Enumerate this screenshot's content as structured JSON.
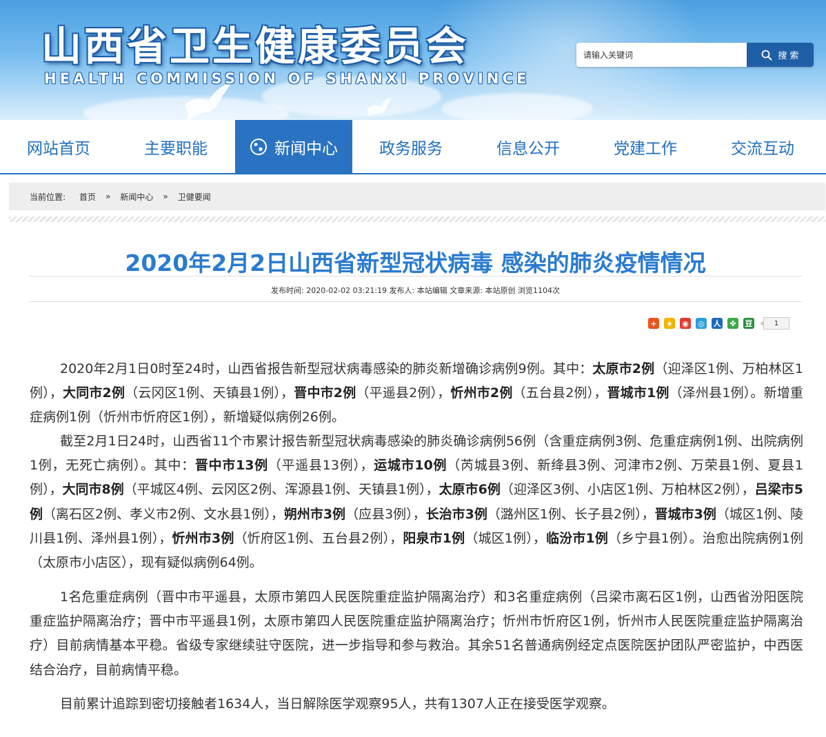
{
  "header": {
    "site_title": "山西省卫生健康委员会",
    "site_subtitle": "HEALTH COMMISSION OF SHANXI PROVINCE",
    "search_placeholder": "请输入关键词",
    "search_button": "搜 索"
  },
  "nav": {
    "items": [
      {
        "label": "网站首页"
      },
      {
        "label": "主要职能"
      },
      {
        "label": "新闻中心",
        "active": true
      },
      {
        "label": "政务服务"
      },
      {
        "label": "信息公开"
      },
      {
        "label": "党建工作"
      },
      {
        "label": "交流互动"
      }
    ]
  },
  "breadcrumb": {
    "lead": "当前位置:",
    "items": [
      "首页",
      "»",
      "新闻中心",
      "»",
      "卫健要闻"
    ]
  },
  "article": {
    "title": "2020年2月2日山西省新型冠状病毒 感染的肺炎疫情情况",
    "meta": "发布时间: 2020-02-02 03:21:19 发布人: 本站编辑 文章来源: 本站原创 浏览1104次",
    "share_count": "1",
    "paragraphs": [
      [
        {
          "t": "2020年2月1日0时至24时，山西省报告新型冠状病毒感染的肺炎新增确诊病例9例。其中："
        },
        {
          "t": "太原市2例",
          "b": true
        },
        {
          "t": "（迎泽区1例、万柏林区1例），"
        },
        {
          "t": "大同市2例",
          "b": true
        },
        {
          "t": "（云冈区1例、天镇县1例），"
        },
        {
          "t": "晋中市2例",
          "b": true
        },
        {
          "t": "（平遥县2例），"
        },
        {
          "t": "忻州市2例",
          "b": true
        },
        {
          "t": "（五台县2例），"
        },
        {
          "t": "晋城市1例",
          "b": true
        },
        {
          "t": "（泽州县1例）。新增重症病例1例（忻州市忻府区1例），新增疑似病例26例。"
        }
      ],
      [
        {
          "t": "截至2月1日24时，山西省11个市累计报告新型冠状病毒感染的肺炎确诊病例56例（含重症病例3例、危重症病例1例、出院病例1例，无死亡病例）。其中："
        },
        {
          "t": "晋中市13例",
          "b": true
        },
        {
          "t": "（平遥县13例），"
        },
        {
          "t": "运城市10例",
          "b": true
        },
        {
          "t": "（芮城县3例、新绛县3例、河津市2例、万荣县1例、夏县1例），"
        },
        {
          "t": "大同市8例",
          "b": true
        },
        {
          "t": "（平城区4例、云冈区2例、浑源县1例、天镇县1例），"
        },
        {
          "t": "太原市6例",
          "b": true
        },
        {
          "t": "（迎泽区3例、小店区1例、万柏林区2例），"
        },
        {
          "t": "吕梁市5例",
          "b": true
        },
        {
          "t": "（离石区2例、孝义市2例、文水县1例），"
        },
        {
          "t": "朔州市3例",
          "b": true
        },
        {
          "t": "（应县3例），"
        },
        {
          "t": "长治市3例",
          "b": true
        },
        {
          "t": "（潞州区1例、长子县2例），"
        },
        {
          "t": "晋城市3例",
          "b": true
        },
        {
          "t": "（城区1例、陵川县1例、泽州县1例），"
        },
        {
          "t": "忻州市3例",
          "b": true
        },
        {
          "t": "（忻府区1例、五台县2例），"
        },
        {
          "t": "阳泉市1例",
          "b": true
        },
        {
          "t": "（城区1例），"
        },
        {
          "t": "临汾市1例",
          "b": true
        },
        {
          "t": "（乡宁县1例）。治愈出院病例1例（太原市小店区），现有疑似病例64例。"
        }
      ],
      [
        {
          "t": "1名危重症病例（晋中市平遥县，太原市第四人民医院重症监护隔离治疗）和3名重症病例（吕梁市离石区1例，山西省汾阳医院重症监护隔离治疗；晋中市平遥县1例，太原市第四人民医院重症监护隔离治疗；忻州市忻府区1例，忻州市人民医院重症监护隔离治疗）目前病情基本平稳。省级专家继续驻守医院，进一步指导和参与救治。其余51名普通病例经定点医院医护团队严密监护，中西医结合治疗，目前病情平稳。"
        }
      ],
      [
        {
          "t": "目前累计追踪到密切接触者1634人，当日解除医学观察95人，共有1307人正在接受医学观察。"
        }
      ]
    ]
  },
  "share_icons": [
    {
      "name": "add-share-icon",
      "glyph": "+",
      "color": "#e8561f"
    },
    {
      "name": "qzone-icon",
      "glyph": "★",
      "color": "#f1b400"
    },
    {
      "name": "weibo-icon",
      "glyph": "◉",
      "color": "#e03a2f"
    },
    {
      "name": "tencent-weibo-icon",
      "glyph": "◎",
      "color": "#2e9fd9"
    },
    {
      "name": "renren-icon",
      "glyph": "人",
      "color": "#1c6bbd"
    },
    {
      "name": "kaixin-icon",
      "glyph": "✤",
      "color": "#3aa94a"
    },
    {
      "name": "douban-icon",
      "glyph": "豆",
      "color": "#2e8f3d"
    }
  ]
}
